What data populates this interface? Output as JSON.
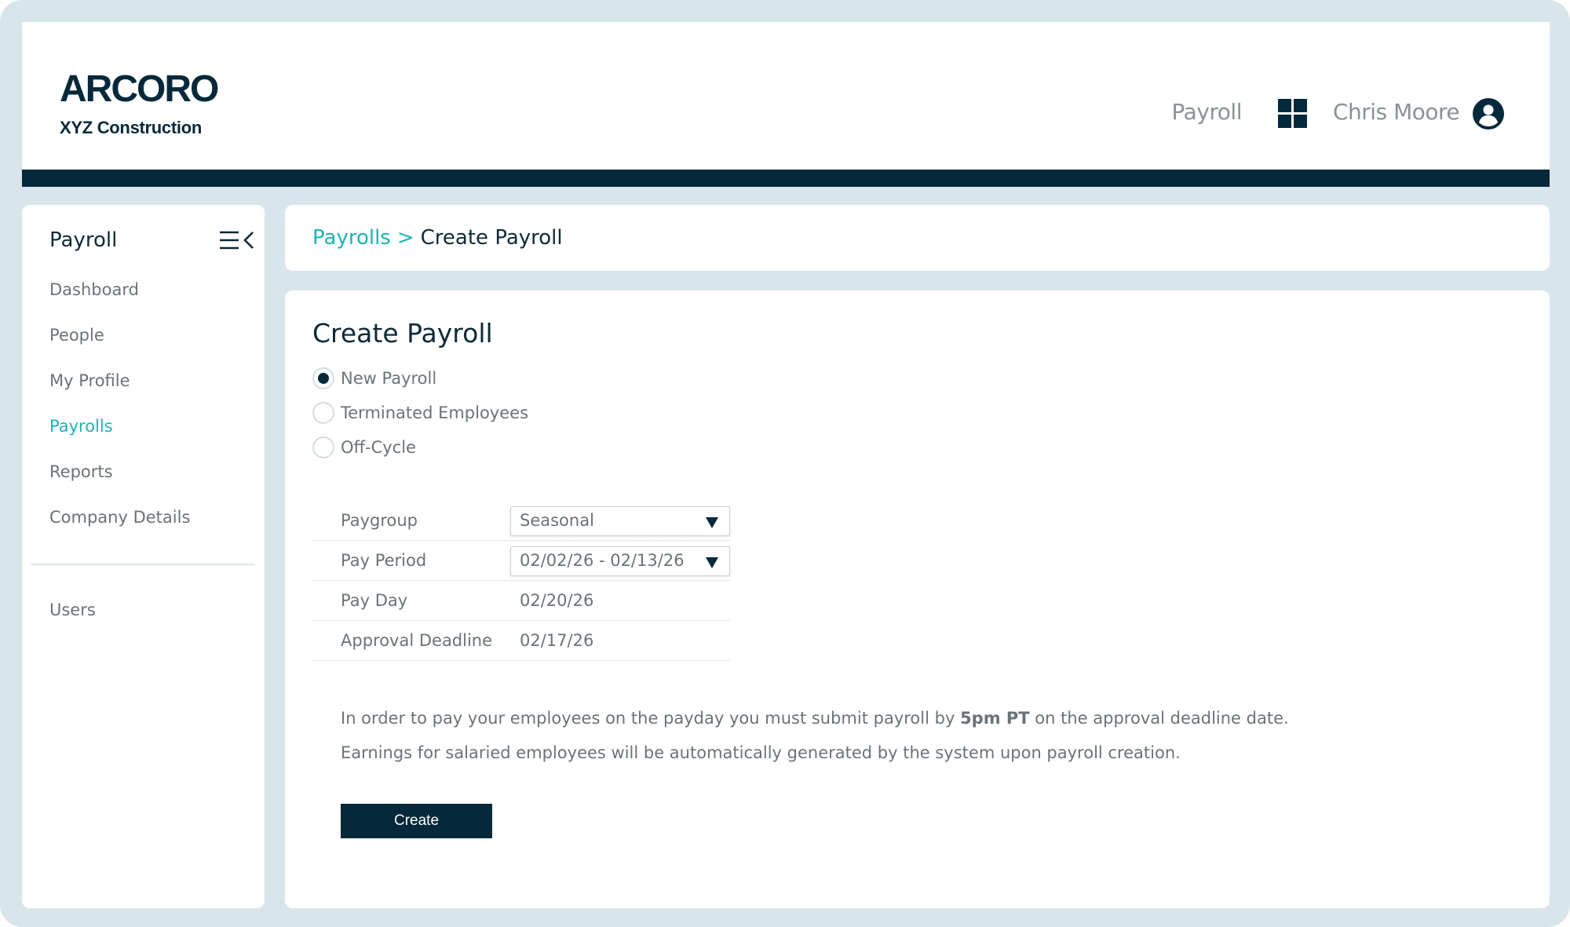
{
  "header": {
    "logo_text": "ARCORO",
    "company_name": "XYZ Construction",
    "app_label": "Payroll",
    "app_switcher_icon": "grid-icon",
    "user_name": "Chris Moore",
    "user_icon": "user-circle-icon"
  },
  "sidebar": {
    "title": "Payroll",
    "collapse_icon": "menu-collapse-icon",
    "items": [
      {
        "label": "Dashboard",
        "active": false
      },
      {
        "label": "People",
        "active": false
      },
      {
        "label": "My Profile",
        "active": false
      },
      {
        "label": "Payrolls",
        "active": true
      },
      {
        "label": "Reports",
        "active": false
      },
      {
        "label": "Company Details",
        "active": false
      }
    ],
    "secondary_items": [
      {
        "label": "Users",
        "active": false
      }
    ]
  },
  "breadcrumb": {
    "parent": "Payrolls",
    "separator": ">",
    "current": "Create Payroll"
  },
  "main": {
    "title": "Create Payroll",
    "payroll_types": [
      {
        "label": "New Payroll",
        "checked": true
      },
      {
        "label": "Terminated Employees",
        "checked": false
      },
      {
        "label": "Off-Cycle",
        "checked": false
      }
    ],
    "form": {
      "paygroup_label": "Paygroup",
      "paygroup_value": "Seasonal",
      "pay_period_label": "Pay Period",
      "pay_period_value": "02/02/26 - 02/13/26",
      "pay_day_label": "Pay Day",
      "pay_day_value": "02/20/26",
      "approval_deadline_label": "Approval Deadline",
      "approval_deadline_value": "02/17/26"
    },
    "info_line1_before": "In order to pay your employees on the payday you must submit payroll by ",
    "info_line1_bold": "5pm PT",
    "info_line1_after": " on the approval deadline date.",
    "info_line2": "Earnings for salaried employees will be automatically generated by the system upon payroll creation.",
    "create_label": "Create"
  },
  "colors": {
    "frame": "#d8e6eb",
    "navy": "#05293b",
    "accent_teal": "#1fb3b5",
    "muted_text": "#6b7278"
  }
}
